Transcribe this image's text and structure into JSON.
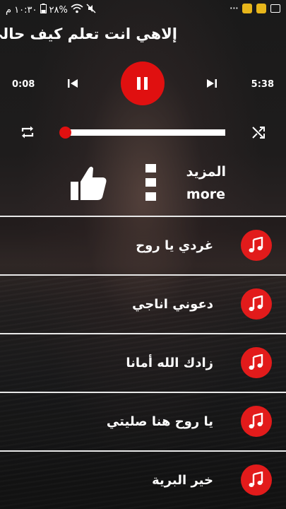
{
  "status_bar": {
    "time": "١٠:٣٠ م",
    "battery": "٢٨%",
    "icons": [
      "battery-icon",
      "wifi-icon",
      "mute-icon",
      "more-dots-icon",
      "app-icon",
      "app-icon",
      "image-icon"
    ]
  },
  "player": {
    "title": "إلاهي انت تعلم كيف حالي",
    "current_time": "0:08",
    "total_time": "5:38",
    "progress": 0.0,
    "state": "playing"
  },
  "actions": {
    "more_ar": "المزيد",
    "more_en": "more"
  },
  "songs": [
    {
      "title": "غردي يا روح"
    },
    {
      "title": "دعوني اناجي"
    },
    {
      "title": "زادك الله أمانا"
    },
    {
      "title": "يا روح هنا صليتي"
    },
    {
      "title": "خير البرية"
    }
  ],
  "colors": {
    "accent": "#e01010",
    "text": "#ffffff"
  }
}
